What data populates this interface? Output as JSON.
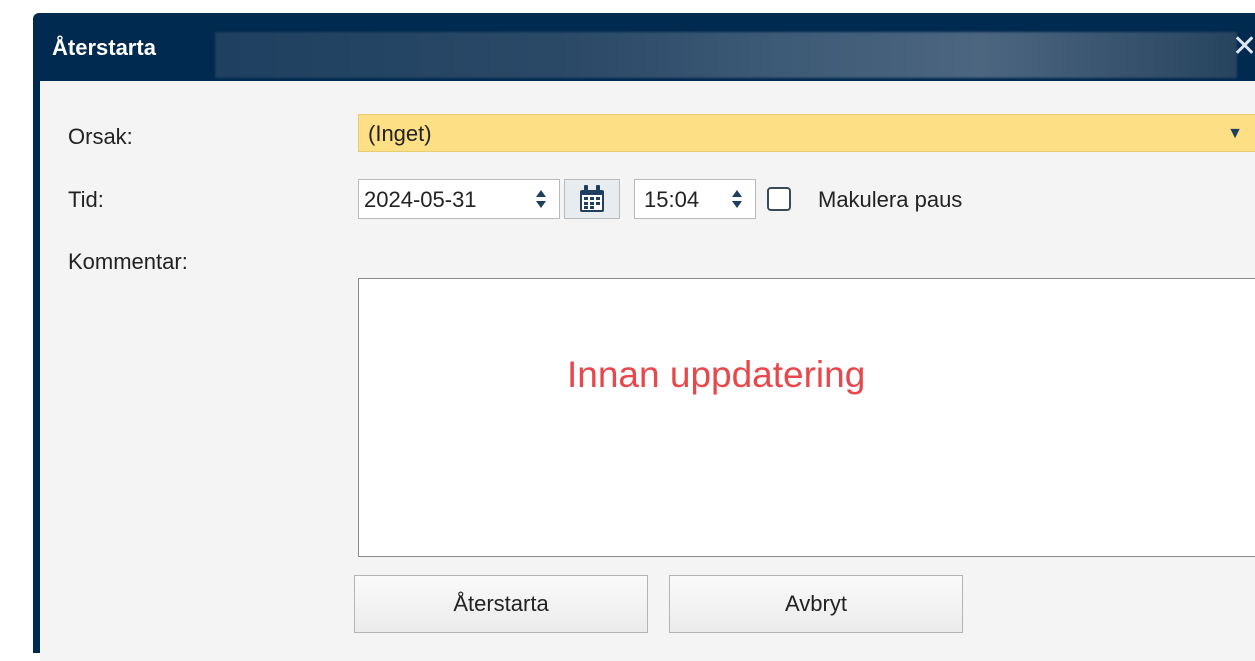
{
  "dialog": {
    "title": "Återstarta",
    "close_glyph": "✕"
  },
  "form": {
    "reason_label": "Orsak:",
    "reason_value": "(Inget)",
    "time_label": "Tid:",
    "date_value": "2024-05-31",
    "time_value": "15:04",
    "void_pause_label": "Makulera paus",
    "void_pause_checked": false,
    "comment_label": "Kommentar:",
    "comment_text": "Innan uppdatering"
  },
  "buttons": {
    "restart": "Återstarta",
    "cancel": "Avbryt"
  },
  "colors": {
    "title_bar": "#002a4f",
    "select_background": "#fddf86",
    "comment_text": "#e8474b"
  },
  "icons": {
    "close": "close-icon",
    "dropdown": "triangle-down-icon",
    "spinner": "spinner-icon",
    "calendar": "calendar-icon"
  }
}
